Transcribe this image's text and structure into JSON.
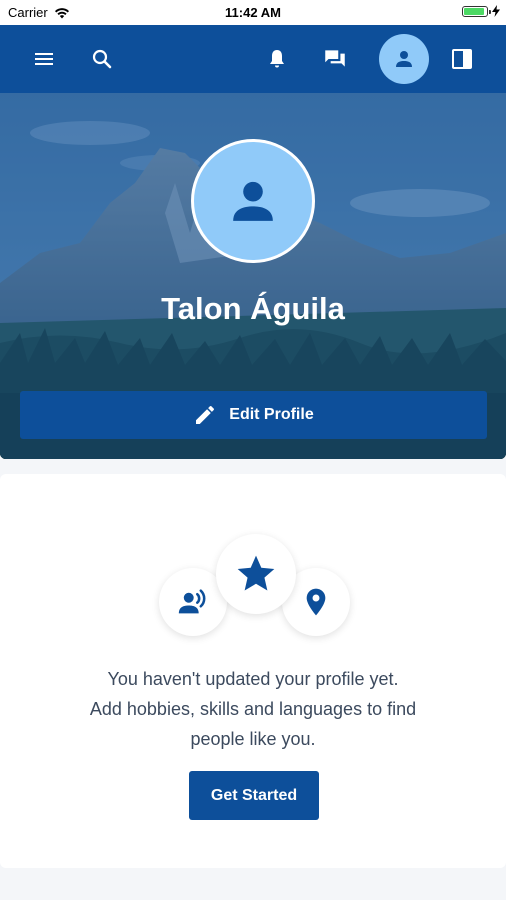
{
  "status_bar": {
    "carrier": "Carrier",
    "time": "11:42 AM"
  },
  "app_bar": {
    "icons": [
      "menu-icon",
      "search-icon",
      "bell-icon",
      "chat-icon",
      "person-icon",
      "sidebar-toggle-icon"
    ]
  },
  "profile": {
    "name": "Talon Águila",
    "edit_label": "Edit Profile"
  },
  "empty_state": {
    "line1": "You haven't updated your profile yet.",
    "line2": "Add hobbies, skills and languages to find",
    "line3": "people like you.",
    "cta_label": "Get Started",
    "icons": [
      "voice-person-icon",
      "star-icon",
      "location-pin-icon"
    ]
  },
  "colors": {
    "primary": "#0d4f9a",
    "avatar_bg": "#90caf9",
    "background": "#f4f6f9",
    "text": "#3c4a5e"
  }
}
